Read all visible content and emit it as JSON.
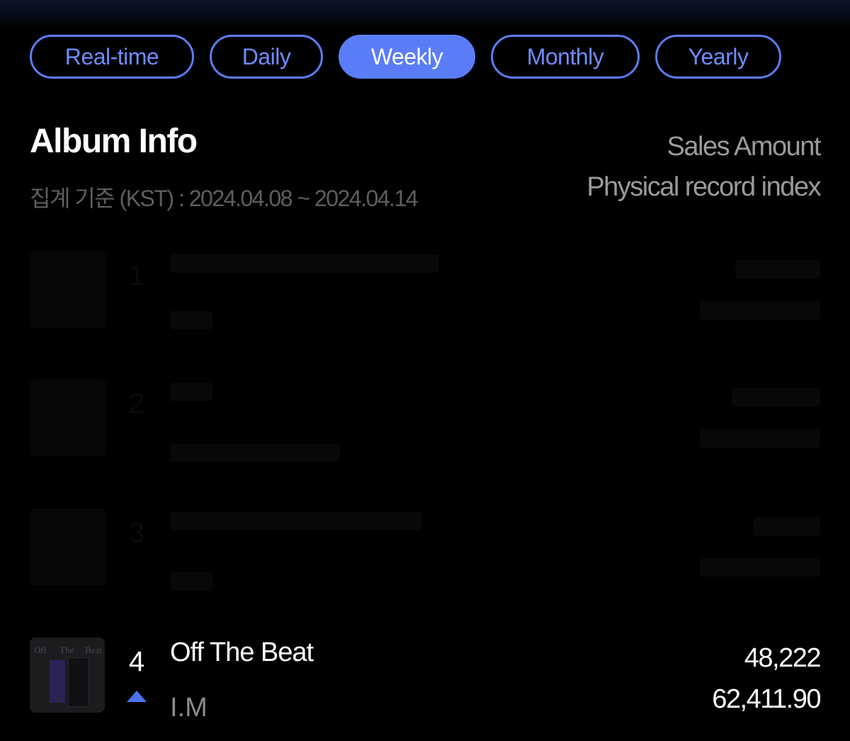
{
  "tabs": [
    {
      "label": "Real-time",
      "active": false
    },
    {
      "label": "Daily",
      "active": false
    },
    {
      "label": "Weekly",
      "active": true
    },
    {
      "label": "Monthly",
      "active": false
    },
    {
      "label": "Yearly",
      "active": false
    }
  ],
  "header": {
    "title": "Album Info",
    "period": "집계 기준 (KST) : 2024.04.08 ~ 2024.04.14",
    "column_1": "Sales Amount",
    "column_2": "Physical record index"
  },
  "colors": {
    "accent": "#5a7df7",
    "tab_text": "#6f8cff",
    "rank_up": "#4a74f0",
    "background": "#000000"
  },
  "rows": [
    {
      "rank": "1",
      "redacted": true
    },
    {
      "rank": "2",
      "redacted": true
    },
    {
      "rank": "3",
      "redacted": true
    },
    {
      "rank": "4",
      "change_icon": "rank-up-triangle",
      "album": "Off The Beat",
      "artist": "I.M",
      "sales_amount": "48,222",
      "physical_record_index": "62,411.90",
      "cover_text": [
        "Off",
        "The",
        "Beat"
      ]
    }
  ]
}
